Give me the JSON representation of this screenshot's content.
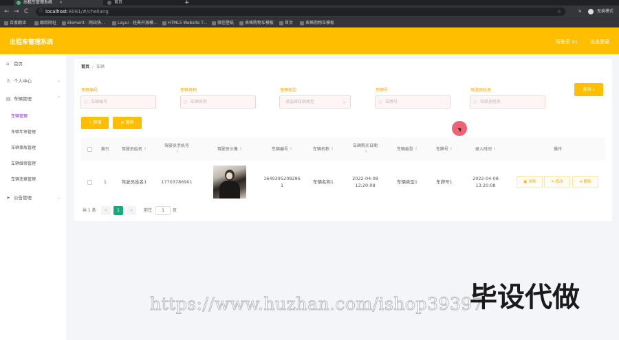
{
  "browser": {
    "tabs": [
      {
        "title": "出租车管理系统"
      },
      {
        "title": "首页"
      }
    ],
    "new_tab": "+",
    "nav": {
      "back": "←",
      "forward": "→",
      "reload": "C"
    },
    "url": {
      "host": "localhost",
      "path": ":8081/#/cheliang"
    },
    "profile_label": "无痕模式",
    "bookmarks": [
      "百度翻译",
      "跟踪网址",
      "Element - 网站快...",
      "Layui - 经典开源模...",
      "HTML5 Website T...",
      "微信壁纸",
      "表格购物车模板",
      "首页",
      "表格购物车模板"
    ]
  },
  "header": {
    "title": "出租车管理系统",
    "user": "驾驶员 a1",
    "logout": "退出登录"
  },
  "sidebar": {
    "items": [
      {
        "label": "首页",
        "icon": "home-icon"
      },
      {
        "label": "个人中心",
        "icon": "user-icon"
      },
      {
        "label": "车辆管理",
        "icon": "car-icon"
      },
      {
        "label": "公告管理",
        "icon": "send-icon"
      }
    ],
    "sub_items": [
      "车辆管理",
      "车辆年审管理",
      "车辆事故管理",
      "车辆维修管理",
      "车辆违章管理"
    ]
  },
  "breadcrumb": {
    "home": "首页",
    "sep": "/",
    "current": "车辆"
  },
  "filters": [
    {
      "label": "车辆编号",
      "placeholder": "车辆编号"
    },
    {
      "label": "车辆名称",
      "placeholder": "车辆名称"
    },
    {
      "label": "车辆类型",
      "placeholder": "请选择车辆类型"
    },
    {
      "label": "车牌号",
      "placeholder": "车牌号"
    },
    {
      "label": "驾驶员姓名",
      "placeholder": "驾驶员姓名"
    }
  ],
  "buttons": {
    "query": "查询",
    "add": "+ 新增",
    "delete": "删除"
  },
  "table": {
    "headers": [
      "索引",
      "驾驶员姓名",
      "驾驶员手机号",
      "驾驶员头像",
      "车辆编号",
      "车辆名称",
      "车辆购买日期",
      "车辆类型",
      "车牌号",
      "录入时间",
      "操作"
    ],
    "rows": [
      {
        "index": "1",
        "driver_name": "驾驶员姓名1",
        "driver_phone": "17703786901",
        "vehicle_no": "1649395208286 1",
        "vehicle_name": "车辆名称1",
        "purchase_date": "2022-04-08 13:20:08",
        "vehicle_type": "车辆类型1",
        "plate_no": "车牌号1",
        "created_at": "2022-04-08 13:20:08"
      }
    ],
    "row_actions": [
      "详情",
      "修改",
      "删除"
    ]
  },
  "pagination": {
    "total": "共 1 条",
    "prev": "<",
    "current": "1",
    "next": ">",
    "goto_label": "前往",
    "goto_value": "1",
    "page_suffix": "页"
  },
  "watermark": {
    "url": "https://www.huzhan.com/ishop39397",
    "text": "毕设代做"
  },
  "colors": {
    "accent": "#ffbf00",
    "active_menu": "#8a2be2",
    "page_active": "#19a97b",
    "label": "#ffa200"
  }
}
